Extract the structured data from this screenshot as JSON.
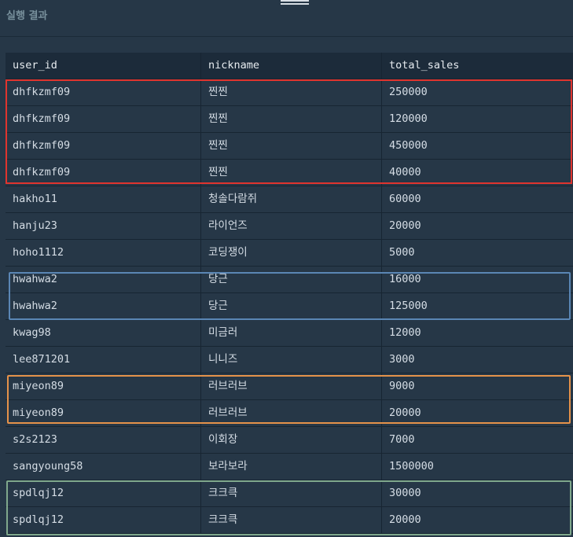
{
  "panel": {
    "title": "실행 결과"
  },
  "table": {
    "columns": [
      "user_id",
      "nickname",
      "total_sales"
    ],
    "rows": [
      [
        "dhfkzmf09",
        "찐찐",
        "250000"
      ],
      [
        "dhfkzmf09",
        "찐찐",
        "120000"
      ],
      [
        "dhfkzmf09",
        "찐찐",
        "450000"
      ],
      [
        "dhfkzmf09",
        "찐찐",
        "40000"
      ],
      [
        "hakho11",
        "청솔다람쥐",
        "60000"
      ],
      [
        "hanju23",
        "라이언즈",
        "20000"
      ],
      [
        "hoho1112",
        "코딩쟁이",
        "5000"
      ],
      [
        "hwahwa2",
        "당근",
        "16000"
      ],
      [
        "hwahwa2",
        "당근",
        "125000"
      ],
      [
        "kwag98",
        "미금러",
        "12000"
      ],
      [
        "lee871201",
        "니니즈",
        "3000"
      ],
      [
        "miyeon89",
        "러브러브",
        "9000"
      ],
      [
        "miyeon89",
        "러브러브",
        "20000"
      ],
      [
        "s2s2123",
        "이회장",
        "7000"
      ],
      [
        "sangyoung58",
        "보라보라",
        "1500000"
      ],
      [
        "spdlqj12",
        "크크큭",
        "30000"
      ],
      [
        "spdlqj12",
        "크크큭",
        "20000"
      ]
    ]
  },
  "highlights": {
    "red": "#e0342e",
    "blue": "#5a86b5",
    "orange": "#e5924a",
    "green": "#7fa88c"
  },
  "colors": {
    "background": "#263747",
    "header_background": "#1c2b3a",
    "text": "#d5dde5",
    "title_text": "#78909c"
  }
}
